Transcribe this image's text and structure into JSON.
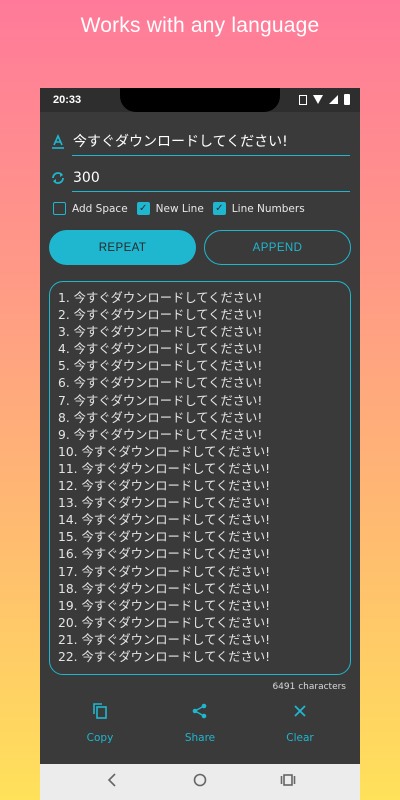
{
  "headline": "Works with any language",
  "status": {
    "time": "20:33"
  },
  "input_text": "今すぐダウンロードしてください!",
  "repeat_count": "300",
  "options": [
    {
      "label": "Add Space",
      "checked": false
    },
    {
      "label": "New Line",
      "checked": true
    },
    {
      "label": "Line Numbers",
      "checked": true
    }
  ],
  "buttons": {
    "repeat": "REPEAT",
    "append": "APPEND"
  },
  "output_lines": [
    "1. 今すぐダウンロードしてください!",
    "2. 今すぐダウンロードしてください!",
    "3. 今すぐダウンロードしてください!",
    "4. 今すぐダウンロードしてください!",
    "5. 今すぐダウンロードしてください!",
    "6. 今すぐダウンロードしてください!",
    "7. 今すぐダウンロードしてください!",
    "8. 今すぐダウンロードしてください!",
    "9. 今すぐダウンロードしてください!",
    "10. 今すぐダウンロードしてください!",
    "11. 今すぐダウンロードしてください!",
    "12. 今すぐダウンロードしてください!",
    "13. 今すぐダウンロードしてください!",
    "14. 今すぐダウンロードしてください!",
    "15. 今すぐダウンロードしてください!",
    "16. 今すぐダウンロードしてください!",
    "17. 今すぐダウンロードしてください!",
    "18. 今すぐダウンロードしてください!",
    "19. 今すぐダウンロードしてください!",
    "20. 今すぐダウンロードしてください!",
    "21. 今すぐダウンロードしてください!",
    "22. 今すぐダウンロードしてください!"
  ],
  "char_count": "6491 characters",
  "actions": [
    {
      "label": "Copy",
      "icon": "copy-icon"
    },
    {
      "label": "Share",
      "icon": "share-icon"
    },
    {
      "label": "Clear",
      "icon": "close-icon"
    }
  ],
  "colors": {
    "accent": "#1fb7cf",
    "background": "#3a3a3a"
  }
}
